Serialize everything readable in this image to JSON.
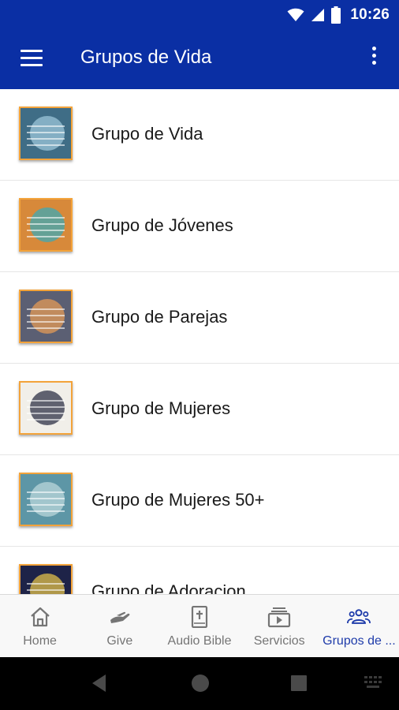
{
  "status_bar": {
    "time": "10:26",
    "icons": [
      "wifi-icon",
      "signal-icon",
      "battery-icon"
    ]
  },
  "app_bar": {
    "title": "Grupos de Vida",
    "menu_icon": "hamburger-menu-icon",
    "overflow_icon": "more-vert-icon",
    "color": "#0a2fa4"
  },
  "list": {
    "items": [
      {
        "label": "Grupo de Vida",
        "thumb_bg": "#3f6d86",
        "thumb_accent": "#9cc6d8"
      },
      {
        "label": "Grupo de Jóvenes",
        "thumb_bg": "#d7893a",
        "thumb_accent": "#3da9b5"
      },
      {
        "label": "Grupo de Parejas",
        "thumb_bg": "#5b5f73",
        "thumb_accent": "#e39a56"
      },
      {
        "label": "Grupo de Mujeres",
        "thumb_bg": "#f1efe9",
        "thumb_accent": "#2e3145"
      },
      {
        "label": "Grupo de Mujeres 50+",
        "thumb_bg": "#5d96a6",
        "thumb_accent": "#b9d6d9"
      },
      {
        "label": "Grupo de Adoracion",
        "thumb_bg": "#1e2348",
        "thumb_accent": "#e1c04a"
      }
    ]
  },
  "bottom_nav": {
    "items": [
      {
        "label": "Home",
        "icon": "home-icon"
      },
      {
        "label": "Give",
        "icon": "give-hand-icon"
      },
      {
        "label": "Audio Bible",
        "icon": "bible-icon"
      },
      {
        "label": "Servicios",
        "icon": "video-play-icon"
      },
      {
        "label": "Grupos de ...",
        "icon": "groups-icon",
        "active": true
      }
    ],
    "active_color": "#1f3caa"
  }
}
